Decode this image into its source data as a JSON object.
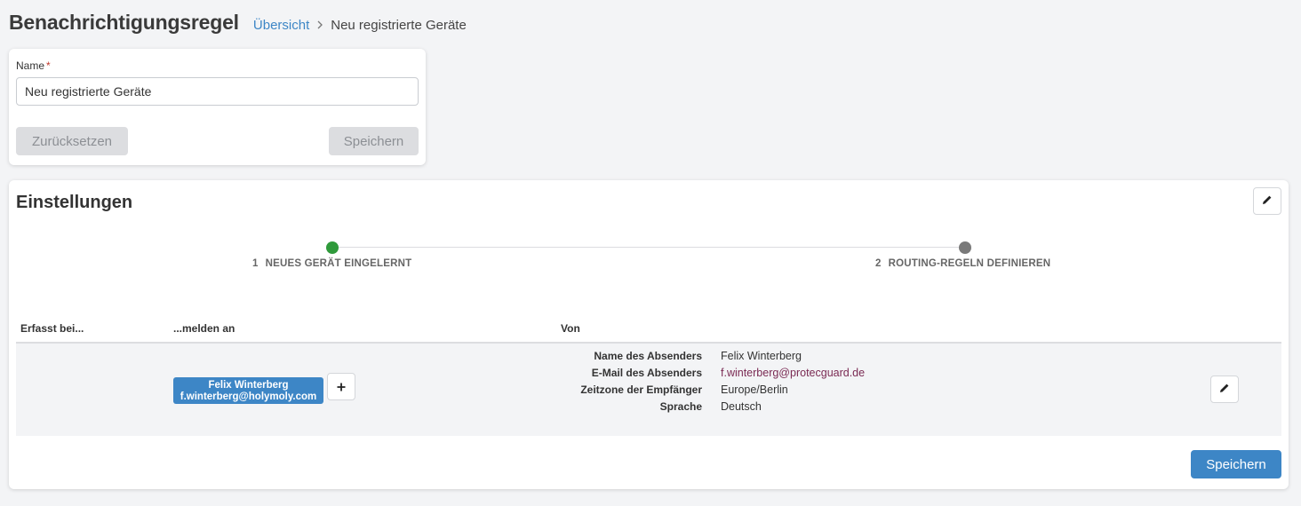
{
  "header": {
    "title": "Benachrichtigungsregel",
    "breadcrumb": {
      "link": "Übersicht",
      "current": "Neu registrierte Geräte"
    }
  },
  "name_card": {
    "label": "Name",
    "required_mark": "*",
    "value": "Neu registrierte Geräte",
    "reset_label": "Zurücksetzen",
    "save_label": "Speichern"
  },
  "settings": {
    "title": "Einstellungen",
    "steps": [
      {
        "number": "1",
        "label": "NEUES GERÄT EINGELERNT",
        "status": "complete",
        "color": "#2f9a3b"
      },
      {
        "number": "2",
        "label": "ROUTING-REGELN DEFINIEREN",
        "status": "pending",
        "color": "#7a7a7a"
      }
    ],
    "table": {
      "headers": [
        "Erfasst bei...",
        "...melden an",
        "Von"
      ],
      "row": {
        "recipient": {
          "name": "Felix Winterberg",
          "email": "f.winterberg@holymoly.com"
        },
        "sender": [
          {
            "key": "Name des Absenders",
            "value": "Felix Winterberg"
          },
          {
            "key": "E-Mail des Absenders",
            "value": "f.winterberg@protecguard.de"
          },
          {
            "key": "Zeitzone der Empfänger",
            "value": "Europe/Berlin"
          },
          {
            "key": "Sprache",
            "value": "Deutsch"
          }
        ]
      }
    },
    "save_label": "Speichern"
  },
  "icons": {
    "edit": "pencil-icon",
    "add": "plus-icon",
    "breadcrumb_separator": "chevron-right-icon"
  },
  "colors": {
    "accent": "#3d86c6",
    "step_complete": "#2f9a3b",
    "step_pending": "#7a7a7a",
    "link_email": "#7a2a53"
  }
}
